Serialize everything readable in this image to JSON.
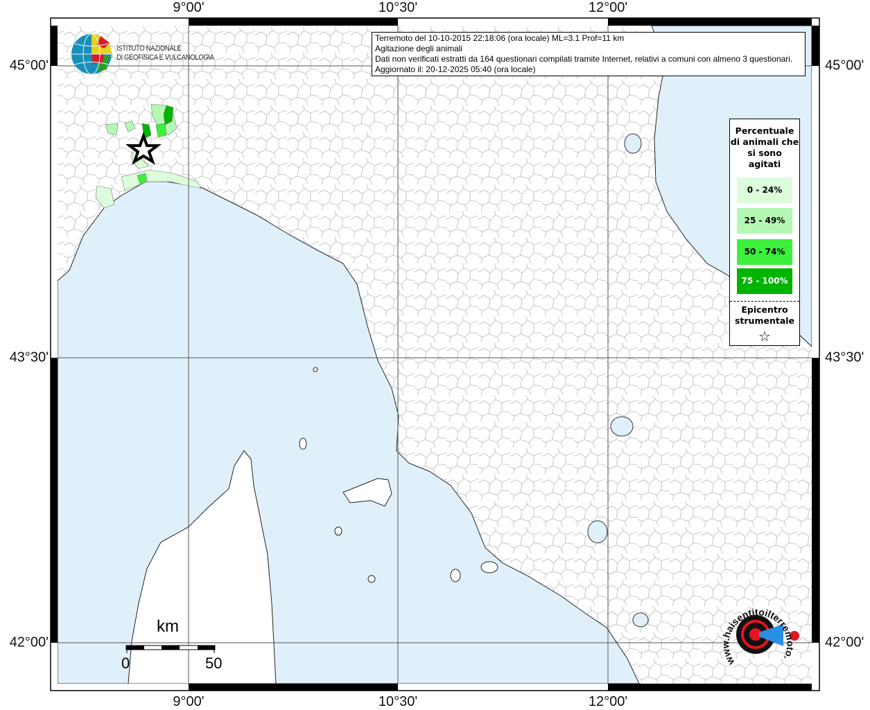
{
  "info_box": {
    "line1": "Terremoto del 10-10-2015 22:18:06 (ora locale) ML=3.1 Prof=11 km",
    "line2": "Agitazione degli animali",
    "line3": "Dati non verificati estratti da 164 questionari compilati tramite Internet, relativi a comuni con almeno 3 questionari.",
    "line4": "Aggiornato il: 20-12-2025 05:40 (ora locale)"
  },
  "axes": {
    "longitude": [
      "9°00'",
      "10°30'",
      "12°00'"
    ],
    "latitude": [
      "45°00'",
      "43°30'",
      "42°00'"
    ]
  },
  "legend": {
    "title": "Percentuale di animali che si sono agitati",
    "classes": [
      {
        "label": "0 - 24%",
        "color": "#dcfcdc",
        "text_color": "#000000"
      },
      {
        "label": "25 - 49%",
        "color": "#b4f8b4",
        "text_color": "#000000"
      },
      {
        "label": "50 - 74%",
        "color": "#3cf03c",
        "text_color": "#000000"
      },
      {
        "label": "75 - 100%",
        "color": "#00b400",
        "text_color": "#ffffff"
      }
    ],
    "epicenter_label": "Epicentro strumentale",
    "epicenter_icon": "star-outline-icon"
  },
  "scale_bar": {
    "unit": "km",
    "start": "0",
    "end": "50"
  },
  "logos": {
    "ingv_line1": "ISTITUTO NAZIONALE",
    "ingv_line2": "DI GEOFISICA E VULCANOLOGIA",
    "hst": "www.haisentitoilterremoto.it"
  },
  "colors": {
    "sea": "#e0f0fb",
    "land": "#ffffff",
    "boundaries": "#b8b8b8",
    "graticule": "#555555"
  }
}
